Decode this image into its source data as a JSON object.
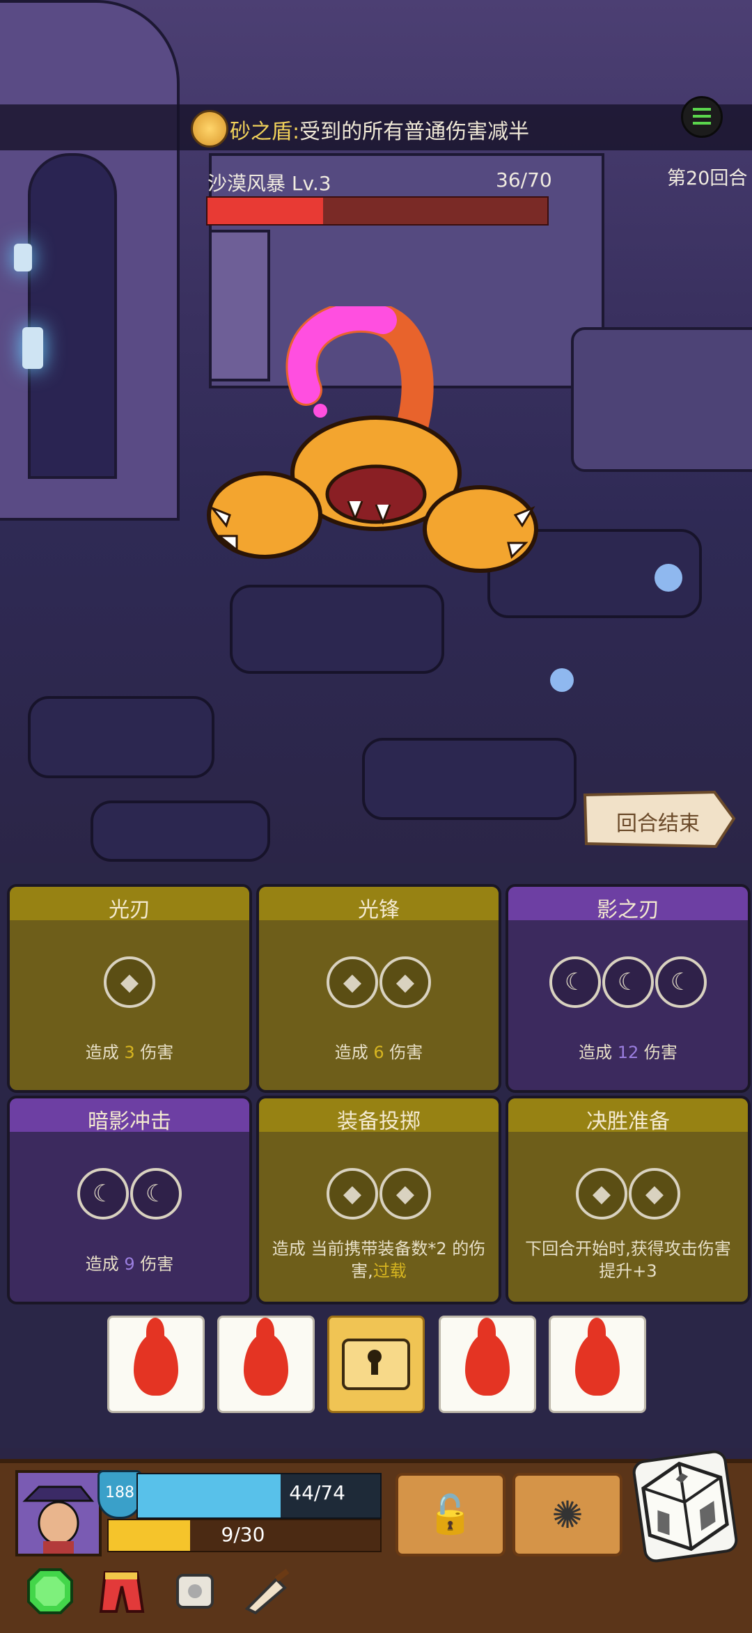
{
  "banner": {
    "skill_name": "砂之盾:",
    "skill_desc": "受到的所有普通伤害减半"
  },
  "enemy": {
    "name": "沙漠风暴 Lv.3",
    "hp_text": "36/70",
    "hp_fraction": 0.34
  },
  "round": {
    "label": "第20回合"
  },
  "end_turn": {
    "label": "回合结束"
  },
  "cards": [
    {
      "title": "光刃",
      "type": "gold",
      "slots": [
        "diamond"
      ],
      "desc_pre": "造成 ",
      "desc_val": "3",
      "desc_post": " 伤害"
    },
    {
      "title": "光锋",
      "type": "gold",
      "slots": [
        "diamond",
        "diamond"
      ],
      "desc_pre": "造成 ",
      "desc_val": "6",
      "desc_post": " 伤害"
    },
    {
      "title": "影之刃",
      "type": "purple",
      "slots": [
        "moon",
        "moon",
        "moon"
      ],
      "desc_pre": "造成 ",
      "desc_val": "12",
      "desc_post": " 伤害"
    },
    {
      "title": "暗影冲击",
      "type": "purple",
      "slots": [
        "moon",
        "moon"
      ],
      "desc_pre": "造成 ",
      "desc_val": "9",
      "desc_post": " 伤害"
    },
    {
      "title": "装备投掷",
      "type": "gold",
      "slots": [
        "diamond",
        "diamond"
      ],
      "desc_pre": "造成 当前携带装备数*2 的伤害,",
      "desc_val": "过载",
      "desc_post": ""
    },
    {
      "title": "决胜准备",
      "type": "gold",
      "slots": [
        "diamond",
        "diamond"
      ],
      "desc_pre": "下回合开始时,获得攻击伤害提升+3",
      "desc_val": "",
      "desc_post": ""
    }
  ],
  "dice_row": [
    "fire-icon",
    "fire-icon",
    "lock-icon",
    "fire-icon",
    "fire-icon"
  ],
  "player": {
    "armor": "188",
    "hp_text": "44/74",
    "hp_fraction": 0.59,
    "xp_text": "9/30",
    "xp_fraction": 0.3
  },
  "skills": [
    "broken-lock-icon",
    "shatter-icon"
  ],
  "relics": [
    "emerald-icon",
    "red-pants-icon",
    "scroll-icon",
    "horn-icon"
  ],
  "colors": {
    "enemy_hp": "#e83a34",
    "player_hp": "#58c1ea",
    "player_xp": "#f5c42b"
  }
}
